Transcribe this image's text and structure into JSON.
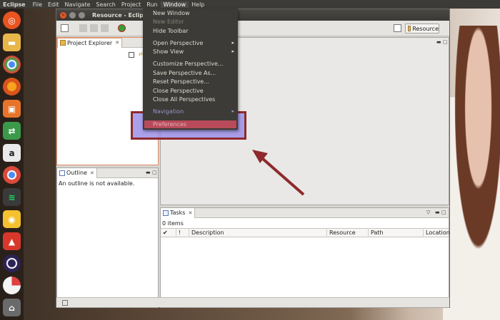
{
  "top_panel": {
    "app_name": "Eclipse",
    "menus": [
      "File",
      "Edit",
      "Navigate",
      "Search",
      "Project",
      "Run",
      "Window",
      "Help"
    ]
  },
  "window": {
    "title": "Resource - Eclipse Pla"
  },
  "toolbar": {
    "perspective_label": "Resource"
  },
  "project_explorer": {
    "tab_label": "Project Explorer"
  },
  "outline": {
    "tab_label": "Outline",
    "message": "An outline is not available."
  },
  "tasks": {
    "tab_label": "Tasks",
    "count": "0 items",
    "columns": [
      "✔",
      "!",
      "Description",
      "Resource",
      "Path",
      "Location"
    ]
  },
  "window_menu": {
    "items": [
      {
        "label": "New Window",
        "disabled": false,
        "submenu": false
      },
      {
        "label": "New Editor",
        "disabled": true,
        "submenu": false
      },
      {
        "label": "Hide Toolbar",
        "disabled": false,
        "submenu": false
      },
      {
        "label": "Open Perspective",
        "disabled": false,
        "submenu": true
      },
      {
        "label": "Show View",
        "disabled": false,
        "submenu": true
      },
      {
        "label": "Customize Perspective...",
        "disabled": false,
        "submenu": false
      },
      {
        "label": "Save Perspective As...",
        "disabled": false,
        "submenu": false
      },
      {
        "label": "Reset Perspective...",
        "disabled": false,
        "submenu": false
      },
      {
        "label": "Close Perspective",
        "disabled": false,
        "submenu": false
      },
      {
        "label": "Close All Perspectives",
        "disabled": false,
        "submenu": false
      },
      {
        "label": "Navigation",
        "disabled": false,
        "submenu": true
      },
      {
        "label": "Preferences",
        "disabled": false,
        "submenu": false
      }
    ]
  },
  "icons": {
    "launcher": [
      "ubuntu-dash-icon",
      "files-icon",
      "chrome-icon",
      "firefox-icon",
      "software-center-icon",
      "settings-icon",
      "amazon-icon",
      "chromium-icon",
      "spotify-icon",
      "idea-icon",
      "app-icon",
      "eclipse-icon",
      "pie-icon",
      "trash-icon"
    ]
  },
  "colors": {
    "accent": "#e95420",
    "highlight_fill": "#9c90e8",
    "highlight_border": "#8e2a2c",
    "arrow": "#8e2a2c"
  }
}
